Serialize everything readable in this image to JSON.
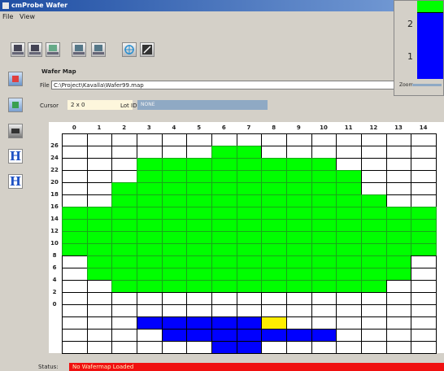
{
  "window": {
    "title": "cmProbe Wafer"
  },
  "menu": [
    "File",
    "View"
  ],
  "toolbar": {
    "buttons": [
      {
        "name": "open-file-button",
        "icon": "open-icon"
      },
      {
        "name": "save-file-button",
        "icon": "save-icon"
      },
      {
        "name": "print-button",
        "icon": "print-icon"
      },
      {
        "name": "edit-button",
        "icon": "edit-icon"
      },
      {
        "name": "bin-button",
        "icon": "bin-icon"
      },
      {
        "name": "target-button",
        "icon": "target-icon"
      },
      {
        "name": "probe-button",
        "icon": "probe-icon"
      }
    ]
  },
  "sidebar": {
    "buttons": [
      {
        "name": "map-view-button",
        "icon": "map-icon",
        "label": ""
      },
      {
        "name": "grid-view-button",
        "icon": "grid-icon",
        "label": ""
      },
      {
        "name": "tester-button",
        "icon": "tester-icon",
        "label": ""
      },
      {
        "name": "h-button-1",
        "icon": "h-icon",
        "label": "H"
      },
      {
        "name": "h-button-2",
        "icon": "h-icon",
        "label": "H"
      }
    ]
  },
  "panel": {
    "title": "Wafer Map",
    "file_label": "File",
    "file_path": "C:\\Project\\Kavalla\\Wafer99.map",
    "cursor_label": "Cursor",
    "cursor_value": "2 x 0",
    "lotid_label": "Lot ID",
    "lotid_value": "NONE"
  },
  "colors": {
    "pass": "#00ff00",
    "fail": "#0000ff",
    "marked": "#ffee00",
    "empty": "#ffffff",
    "status_bar": "#f01010"
  },
  "map": {
    "columns": [
      "0",
      "1",
      "2",
      "3",
      "4",
      "5",
      "6",
      "7",
      "8",
      "9",
      "10",
      "11",
      "12",
      "13",
      "14"
    ],
    "rows": [
      "26",
      "24",
      "22",
      "20",
      "18",
      "16",
      "14",
      "12",
      "10",
      "8",
      "6",
      "4",
      "2",
      "0"
    ],
    "green_ranges": [
      [
        -1,
        -1
      ],
      [
        6,
        7
      ],
      [
        3,
        10
      ],
      [
        3,
        11
      ],
      [
        2,
        11
      ],
      [
        2,
        12
      ],
      [
        0,
        14
      ],
      [
        0,
        14
      ],
      [
        0,
        14
      ],
      [
        0,
        14
      ],
      [
        1,
        13
      ],
      [
        1,
        13
      ],
      [
        2,
        12
      ],
      [
        -1,
        -1
      ],
      [
        -1,
        -1
      ],
      [
        -1,
        -1
      ],
      [
        -1,
        -1
      ],
      [
        -1,
        -1
      ]
    ],
    "blue_cells": [
      [
        15,
        3
      ],
      [
        15,
        4
      ],
      [
        15,
        5
      ],
      [
        15,
        6
      ],
      [
        15,
        7
      ],
      [
        15,
        8
      ],
      [
        16,
        4
      ],
      [
        16,
        5
      ],
      [
        16,
        6
      ],
      [
        16,
        7
      ],
      [
        16,
        8
      ],
      [
        16,
        9
      ],
      [
        16,
        10
      ],
      [
        17,
        6
      ],
      [
        17,
        7
      ]
    ],
    "yellow_cells": [
      [
        15,
        8
      ]
    ]
  },
  "status": {
    "label": "Status:",
    "message": "No Wafermap Loaded"
  },
  "popup": {
    "y_ticks": [
      "2",
      "1"
    ],
    "zoom_label": "Zoom"
  }
}
